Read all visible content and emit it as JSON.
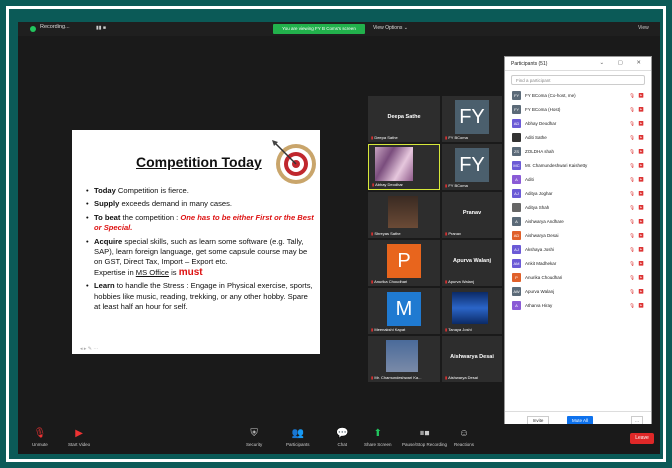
{
  "topbar": {
    "recording": "Recording...",
    "pause": "▮▮ ■",
    "viewing": "You are viewing FY B Coms's screen",
    "view_options": "View Options ⌄",
    "view": "View"
  },
  "slide": {
    "title": "Competition Today",
    "b1_bold": "Today",
    "b1_rest": " Competition is fierce.",
    "b2_bold": "Supply",
    "b2_rest": " exceeds demand in many cases.",
    "b3_bold": "To beat",
    "b3_rest": " the competition : ",
    "b3_red": "One has to be either First or the Best or Special.",
    "b4_bold": "Acquire",
    "b4_rest": " special skills, such as learn some software (e.g. Tally, SAP), learn foreign language, get some capsule course may be on GST, Direct Tax, Import – Export etc.",
    "b4b_pre": "Expertise in ",
    "b4b_u": "MS Office",
    "b4b_mid": " is ",
    "b4b_must": "must",
    "b5_bold": "Learn",
    "b5_rest": " to handle the Stress : Engage in Physical exercise, sports, hobbies like music, reading, trekking, or any other hobby. Spare at least half an hour for self."
  },
  "gallery": {
    "t1_big": "Deepa Sathe",
    "t1_nm": "Deepa Sathe",
    "t2_av": "FY",
    "t2_nm": "FY BComa",
    "t3_nm": "Abhay Deodhar",
    "t4_av": "FY",
    "t4_nm": "FY BComa",
    "t5_nm": "Shreyas Sathe",
    "t6_big": "Pranav",
    "t6_nm": "Pranav",
    "t7_av": "P",
    "t7_nm": "Anurika Choudhari",
    "t8_big": "Apurva Walanj",
    "t8_nm": "Apurva Walanj",
    "t9_av": "M",
    "t9_nm": "Meenakshi Kapat",
    "t10_nm": "Tanaya Joshi",
    "t11_nm": "Mr. Chamundeshwari Ka...",
    "t12_big": "Aishwarya Desai",
    "t12_nm": "Aishwarya Desai"
  },
  "panel": {
    "title": "Participants (51)",
    "controls": "⌄ ▢ ✕",
    "search": "Find a participant",
    "participants": [
      {
        "name": "FY BComa (Co-host, me)",
        "initials": "FY",
        "color": "#5b6a78"
      },
      {
        "name": "FY BComa (Host)",
        "initials": "FY",
        "color": "#5b6a78"
      },
      {
        "name": "Abhay Deodhar",
        "initials": "AD",
        "color": "#6b5ad6"
      },
      {
        "name": "Aditi Sathe",
        "initials": "",
        "color": "#333333"
      },
      {
        "name": "ZOLDHA shah",
        "initials": "ZS",
        "color": "#5b6a78"
      },
      {
        "name": "Mr. Chamundeshwari Kaishetty",
        "initials": "MC",
        "color": "#6b5ad6"
      },
      {
        "name": "Aditi",
        "initials": "A",
        "color": "#8a5bd6"
      },
      {
        "name": "Aditya Joghar",
        "initials": "AJ",
        "color": "#6b5ad6"
      },
      {
        "name": "Aditya Shah",
        "initials": "",
        "color": "#666666"
      },
      {
        "name": "Aishwarya Andhare",
        "initials": "A",
        "color": "#5b6a78"
      },
      {
        "name": "Aishwarya Desai",
        "initials": "AD",
        "color": "#e0602a"
      },
      {
        "name": "Akshaya Joshi",
        "initials": "AJ",
        "color": "#6b5ad6"
      },
      {
        "name": "Ankit Madhekar",
        "initials": "AM",
        "color": "#6b5ad6"
      },
      {
        "name": "Anurika Choudhari",
        "initials": "P",
        "color": "#e0602a"
      },
      {
        "name": "Apurva Walanj",
        "initials": "AW",
        "color": "#5b6a78"
      },
      {
        "name": "Atharva Hiray",
        "initials": "A",
        "color": "#8a5bd6"
      }
    ],
    "invite": "Invite",
    "mute_all": "Mute All",
    "more": "..."
  },
  "toolbar": {
    "unmute": "Unmute",
    "start_video": "Start Video",
    "security": "Security",
    "participants": "Participants",
    "chat": "Chat",
    "share": "Share Screen",
    "record": "Pause/Stop Recording",
    "reactions": "Reactions",
    "leave": "Leave"
  }
}
